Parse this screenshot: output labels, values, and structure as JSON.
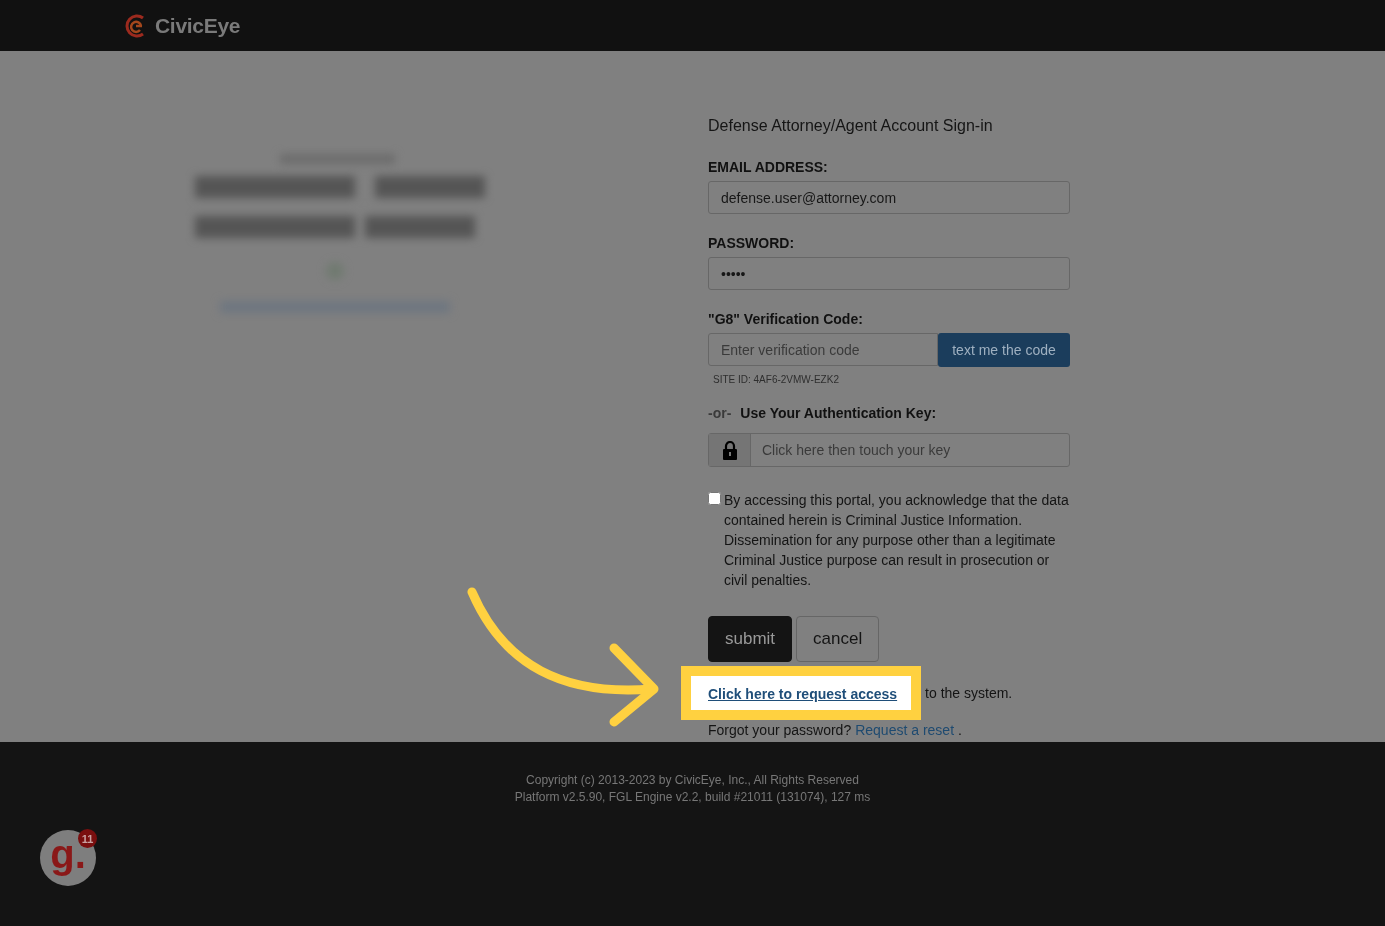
{
  "header": {
    "brand": "CivicEye"
  },
  "form": {
    "title": "Defense Attorney/Agent Account Sign-in",
    "email": {
      "label": "EMAIL ADDRESS:",
      "value": "defense.user@attorney.com"
    },
    "password": {
      "label": "PASSWORD:",
      "value": "•••••"
    },
    "verification": {
      "label": "\"G8\" Verification Code:",
      "placeholder": "Enter verification code",
      "button": "text me the code",
      "site_id": "SITE ID: 4AF6-2VMW-EZK2"
    },
    "auth_key": {
      "or": "-or-",
      "label": "Use Your Authentication Key:",
      "placeholder": "Click here then touch your key"
    },
    "consent": {
      "checked": false,
      "text": "By accessing this portal, you acknowledge that the data contained herein is Criminal Justice Information. Dissemination for any purpose other than a legitimate Criminal Justice purpose can result in prosecution or civil penalties."
    },
    "buttons": [
      {
        "kind": "primary",
        "label": "submit"
      },
      {
        "kind": "secondary",
        "label": "cancel"
      }
    ],
    "request": {
      "link": "Click here to request access",
      "rest": "to the system."
    },
    "forgot": {
      "text": "Forgot your password?",
      "link": "Request a reset",
      "end": "."
    }
  },
  "footer": {
    "lines": [
      "Copyright (c) 2013-2023 by CivicEye, Inc., All Rights Reserved",
      "Platform v2.5.90, FGL Engine v2.2, build #21011 (131074), 127 ms"
    ]
  },
  "launcher": {
    "label": "g.",
    "badge": "11"
  }
}
